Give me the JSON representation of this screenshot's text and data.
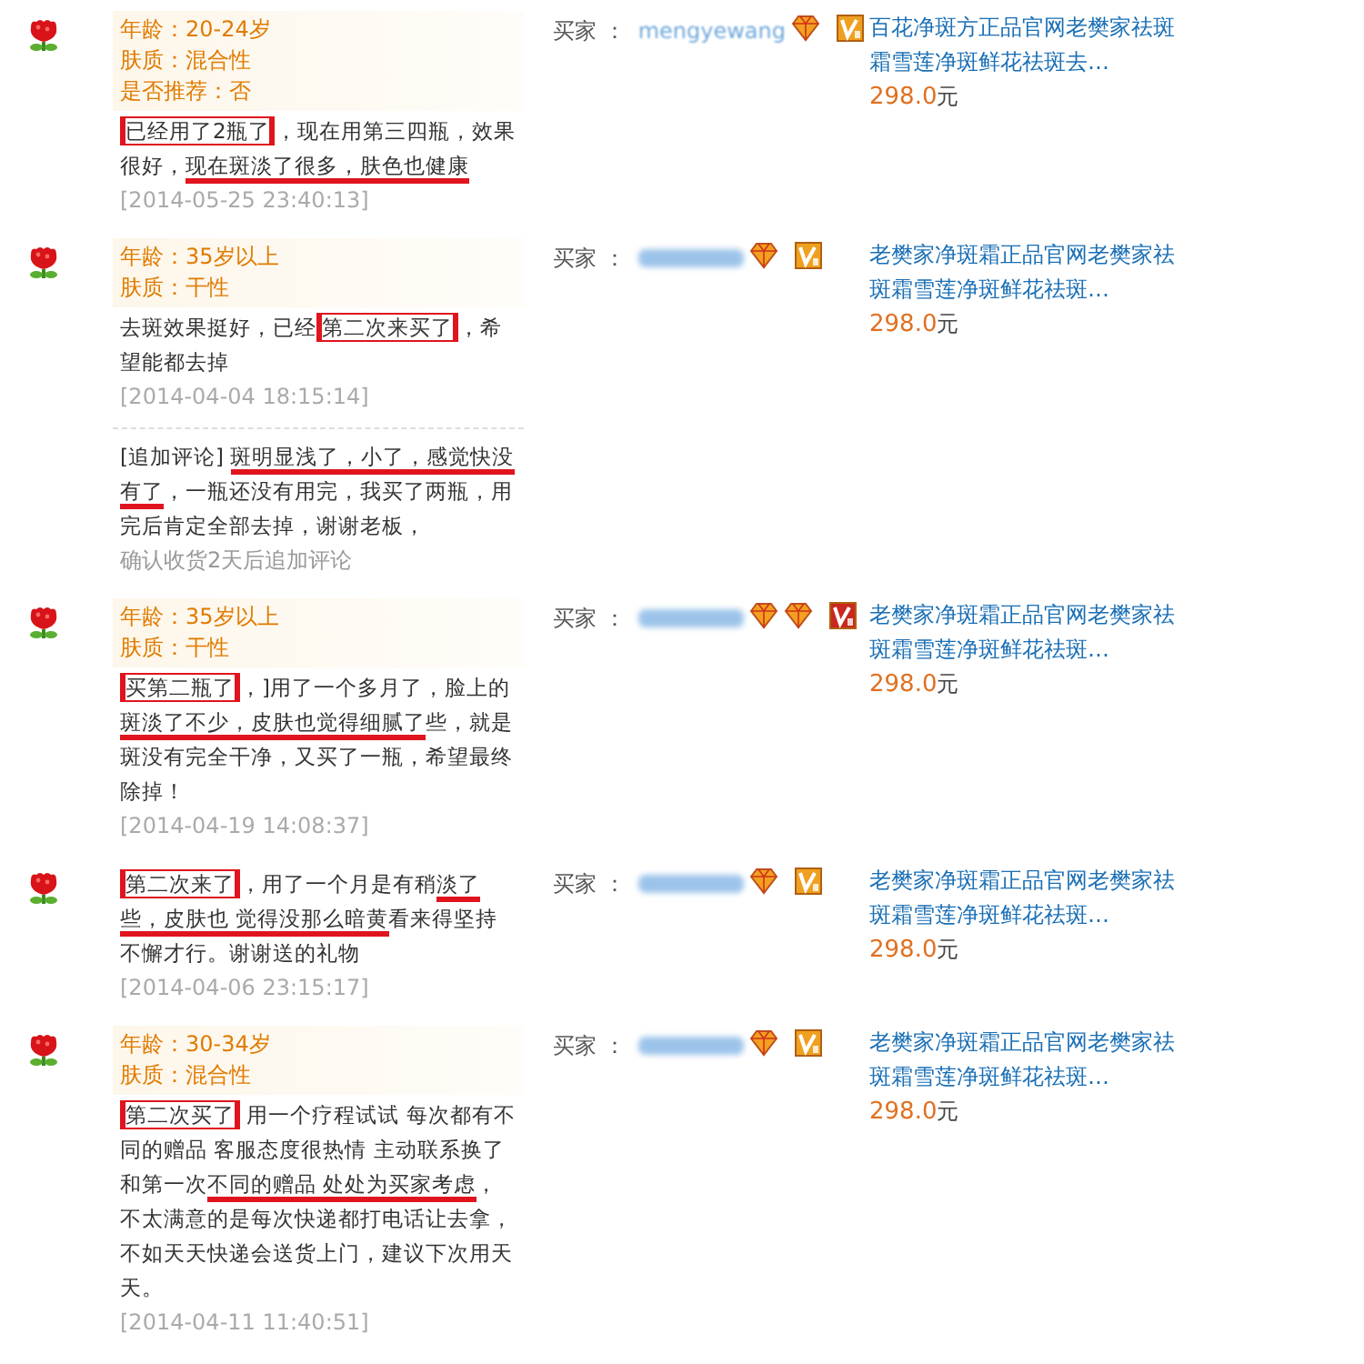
{
  "reviews": [
    {
      "tags": [
        "年龄：20-24岁",
        "肤质：混合性",
        "是否推荐：否"
      ],
      "segments": [
        {
          "text": "已经用了2瓶了",
          "boxed": true,
          "underlined": false
        },
        {
          "text": "，现在用第三四瓶，效果很好，",
          "boxed": false,
          "underlined": false
        },
        {
          "text": "现在斑淡了很多，肤色也健康",
          "boxed": false,
          "underlined": true
        }
      ],
      "date": "[2014-05-25 23:40:13]",
      "buyer": {
        "label": "买家 ：",
        "name": "mengyewang",
        "badges": [
          {
            "kind": "diamond"
          },
          {
            "kind": "vip",
            "color": "#f0a020"
          }
        ]
      },
      "product": {
        "title": "百花净斑方正品官网老樊家祛斑霜雪莲净斑鲜花祛斑去…",
        "price": "298.0",
        "unit": "元"
      }
    },
    {
      "tags": [
        "年龄：35岁以上",
        "肤质：干性"
      ],
      "segments": [
        {
          "text": "去斑效果挺好，已经",
          "boxed": false,
          "underlined": false
        },
        {
          "text": "第二次来买了",
          "boxed": true,
          "underlined": false
        },
        {
          "text": "，希望能都去掉",
          "boxed": false,
          "underlined": false
        }
      ],
      "date": "[2014-04-04 18:15:14]",
      "followup": {
        "segments": [
          {
            "text": "[追加评论] ",
            "boxed": false,
            "underlined": false
          },
          {
            "text": "斑明显浅了，小了，感觉快没有了",
            "boxed": false,
            "underlined": true
          },
          {
            "text": "，一瓶还没有用完，我买了两瓶，用完后肯定全部去掉，谢谢老板，",
            "boxed": false,
            "underlined": false
          }
        ],
        "note": "确认收货2天后追加评论"
      },
      "buyer": {
        "label": "买家 ：",
        "badges": [
          {
            "kind": "diamond"
          },
          {
            "kind": "vip",
            "color": "#f0a020"
          }
        ]
      },
      "product": {
        "title": "老樊家净斑霜正品官网老樊家祛斑霜雪莲净斑鲜花祛斑…",
        "price": "298.0",
        "unit": "元"
      }
    },
    {
      "tags": [
        "年龄：35岁以上",
        "肤质：干性"
      ],
      "segments": [
        {
          "text": "买第二瓶了",
          "boxed": true,
          "underlined": false
        },
        {
          "text": "，]用了一个多月了，脸上的",
          "boxed": false,
          "underlined": false
        },
        {
          "text": "斑淡了不少，皮肤也觉得细腻了",
          "boxed": false,
          "underlined": true
        },
        {
          "text": "些，就是斑没有完全干净，又买了一瓶，希望最终除掉！",
          "boxed": false,
          "underlined": false
        }
      ],
      "date": "[2014-04-19 14:08:37]",
      "buyer": {
        "label": "买家 ：",
        "badges": [
          {
            "kind": "diamond"
          },
          {
            "kind": "diamond"
          },
          {
            "kind": "vip",
            "color": "#c8281e"
          }
        ]
      },
      "product": {
        "title": "老樊家净斑霜正品官网老樊家祛斑霜雪莲净斑鲜花祛斑…",
        "price": "298.0",
        "unit": "元"
      }
    },
    {
      "segments": [
        {
          "text": "第二次来了",
          "boxed": true,
          "underlined": false
        },
        {
          "text": "，用了一个月是有稍",
          "boxed": false,
          "underlined": false
        },
        {
          "text": "淡了些，皮肤也 觉得没那么暗黄",
          "boxed": false,
          "underlined": true
        },
        {
          "text": "看来得坚持不懈才行。谢谢送的礼物",
          "boxed": false,
          "underlined": false
        }
      ],
      "date": "[2014-04-06 23:15:17]",
      "buyer": {
        "label": "买家 ：",
        "badges": [
          {
            "kind": "diamond"
          },
          {
            "kind": "vip",
            "color": "#f0a020"
          }
        ]
      },
      "product": {
        "title": "老樊家净斑霜正品官网老樊家祛斑霜雪莲净斑鲜花祛斑…",
        "price": "298.0",
        "unit": "元"
      }
    },
    {
      "tags": [
        "年龄：30-34岁",
        "肤质：混合性"
      ],
      "segments": [
        {
          "text": "第二次买了",
          "boxed": true,
          "underlined": false
        },
        {
          "text": " 用一个疗程试试 每次都有不同的赠品 客服态度很热情 主动联系换了和第一次",
          "boxed": false,
          "underlined": false
        },
        {
          "text": "不同的赠品 处处为买家考虑",
          "boxed": false,
          "underlined": true
        },
        {
          "text": "，不太满意的是每次快递都打电话让去拿，不如天天快递会送货上门，建议下次用天天。",
          "boxed": false,
          "underlined": false
        }
      ],
      "date": "[2014-04-11 11:40:51]",
      "buyer": {
        "label": "买家 ：",
        "badges": [
          {
            "kind": "diamond"
          },
          {
            "kind": "vip",
            "color": "#f0a020"
          }
        ]
      },
      "product": {
        "title": "老樊家净斑霜正品官网老樊家祛斑霜雪莲净斑鲜花祛斑…",
        "price": "298.0",
        "unit": "元"
      }
    }
  ]
}
